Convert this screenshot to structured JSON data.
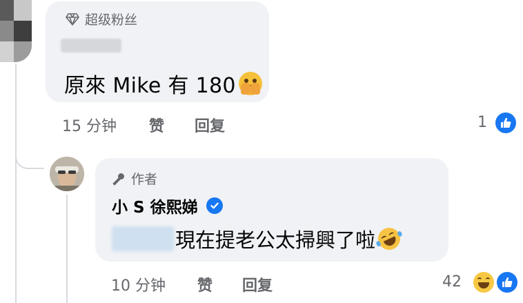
{
  "comment1": {
    "badge": "超级粉丝",
    "text": "原來 Mike 有 180",
    "emoji": "face-with-hand-over-mouth-emoji",
    "time": "15 分钟",
    "like_label": "赞",
    "reply_label": "回复",
    "reaction_count": "1",
    "reactions": [
      "like"
    ]
  },
  "reply1": {
    "badge": "作者",
    "author": "小 S 徐熙娣",
    "verified": true,
    "text": "現在提老公太掃興了啦",
    "emoji": "rolling-on-floor-laughing-emoji",
    "time": "10 分钟",
    "like_label": "赞",
    "reply_label": "回复",
    "reaction_count": "42",
    "reactions": [
      "haha",
      "like"
    ]
  },
  "colors": {
    "bubble": "#f0f2f5",
    "meta_text": "#65676b",
    "accent": "#1877f2",
    "thread_line": "#d8dadf"
  }
}
